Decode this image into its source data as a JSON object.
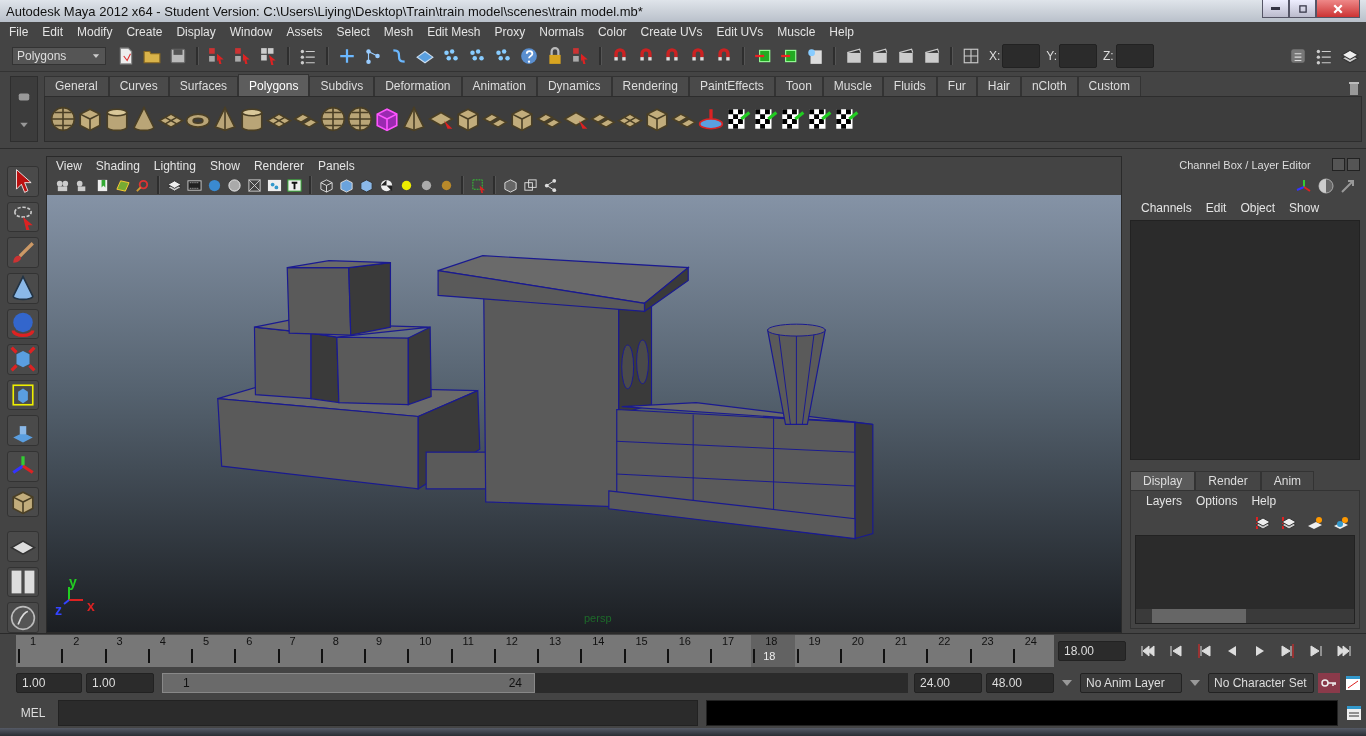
{
  "window": {
    "title": "Autodesk Maya 2012 x64 - Student Version: C:\\Users\\Liying\\Desktop\\Train\\train model\\scenes\\train model.mb*"
  },
  "menu_bar": [
    "File",
    "Edit",
    "Modify",
    "Create",
    "Display",
    "Window",
    "Assets",
    "Select",
    "Mesh",
    "Edit Mesh",
    "Proxy",
    "Normals",
    "Color",
    "Create UVs",
    "Edit UVs",
    "Muscle",
    "Help"
  ],
  "status_line": {
    "mode": "Polygons",
    "coordinate_fields": [
      {
        "label": "X:"
      },
      {
        "label": "Y:"
      },
      {
        "label": "Z:"
      }
    ]
  },
  "shelf": {
    "tabs": [
      {
        "label": "General",
        "selected": false
      },
      {
        "label": "Curves",
        "selected": false
      },
      {
        "label": "Surfaces",
        "selected": false
      },
      {
        "label": "Polygons",
        "selected": true
      },
      {
        "label": "Subdivs",
        "selected": false
      },
      {
        "label": "Deformation",
        "selected": false
      },
      {
        "label": "Animation",
        "selected": false
      },
      {
        "label": "Dynamics",
        "selected": false
      },
      {
        "label": "Rendering",
        "selected": false
      },
      {
        "label": "PaintEffects",
        "selected": false
      },
      {
        "label": "Toon",
        "selected": false
      },
      {
        "label": "Muscle",
        "selected": false
      },
      {
        "label": "Fluids",
        "selected": false
      },
      {
        "label": "Fur",
        "selected": false
      },
      {
        "label": "Hair",
        "selected": false
      },
      {
        "label": "nCloth",
        "selected": false
      },
      {
        "label": "Custom",
        "selected": false
      }
    ]
  },
  "viewport": {
    "menus": [
      "View",
      "Shading",
      "Lighting",
      "Show",
      "Renderer",
      "Panels"
    ],
    "axis_labels": [
      {
        "label": "y",
        "color": "#22cc22"
      },
      {
        "label": "z",
        "color": "#3344ff"
      },
      {
        "label": "x",
        "color": "#dd2222"
      }
    ],
    "camera_label": "persp"
  },
  "channel_box": {
    "title": "Channel Box / Layer Editor",
    "menus": [
      "Channels",
      "Edit",
      "Object",
      "Show"
    ],
    "layer_tabs": [
      {
        "label": "Display",
        "selected": true
      },
      {
        "label": "Render",
        "selected": false
      },
      {
        "label": "Anim",
        "selected": false
      }
    ],
    "layer_menus": [
      "Layers",
      "Options",
      "Help"
    ]
  },
  "time_slider": {
    "ticks": [
      {
        "label": "1",
        "selected": false
      },
      {
        "label": "2",
        "selected": false
      },
      {
        "label": "3",
        "selected": false
      },
      {
        "label": "4",
        "selected": false
      },
      {
        "label": "5",
        "selected": false
      },
      {
        "label": "6",
        "selected": false
      },
      {
        "label": "7",
        "selected": false
      },
      {
        "label": "8",
        "selected": false
      },
      {
        "label": "9",
        "selected": false
      },
      {
        "label": "10",
        "selected": false
      },
      {
        "label": "11",
        "selected": false
      },
      {
        "label": "12",
        "selected": false
      },
      {
        "label": "13",
        "selected": false
      },
      {
        "label": "14",
        "selected": false
      },
      {
        "label": "15",
        "selected": false
      },
      {
        "label": "16",
        "selected": false
      },
      {
        "label": "17",
        "selected": false
      },
      {
        "label": "18",
        "selected": true
      },
      {
        "label": "19",
        "selected": false
      },
      {
        "label": "20",
        "selected": false
      },
      {
        "label": "21",
        "selected": false
      },
      {
        "label": "22",
        "selected": false
      },
      {
        "label": "23",
        "selected": false
      },
      {
        "label": "24",
        "selected": false
      }
    ],
    "current_frame_label": "18",
    "current_time": "18.00"
  },
  "range_slider": {
    "start_time": "1.00",
    "playback_start": "1.00",
    "range_start": "1",
    "range_end": "24",
    "level": 0.5,
    "playback_end": "24.00",
    "end_time": "48.00",
    "anim_layer": "No Anim Layer",
    "character_set": "No Character Set"
  },
  "command_line": {
    "language": "MEL"
  }
}
